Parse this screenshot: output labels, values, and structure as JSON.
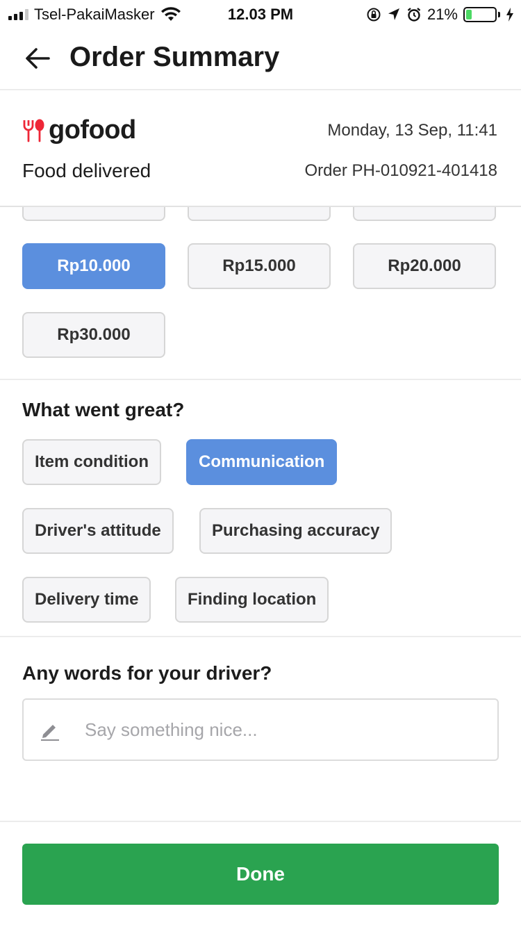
{
  "status_bar": {
    "carrier": "Tsel-PakaiMasker",
    "time": "12.03 PM",
    "battery_percent": "21%",
    "battery_level": 0.21
  },
  "header": {
    "title": "Order Summary"
  },
  "order": {
    "brand": "gofood",
    "brand_color": "#ee2737",
    "date": "Monday, 13 Sep, 11:41",
    "status": "Food delivered",
    "order_id": "Order PH-010921-401418"
  },
  "tip_options": [
    {
      "label": "Rp10.000",
      "selected": true
    },
    {
      "label": "Rp15.000",
      "selected": false
    },
    {
      "label": "Rp20.000",
      "selected": false
    },
    {
      "label": "Rp30.000",
      "selected": false
    }
  ],
  "great": {
    "title": "What went great?",
    "tags": [
      {
        "label": "Item condition",
        "selected": false
      },
      {
        "label": "Communication",
        "selected": true
      },
      {
        "label": "Driver's attitude",
        "selected": false
      },
      {
        "label": "Purchasing accuracy",
        "selected": false
      },
      {
        "label": "Delivery time",
        "selected": false
      },
      {
        "label": "Finding location",
        "selected": false
      }
    ]
  },
  "driver_words": {
    "title": "Any words for your driver?",
    "placeholder": "Say something nice...",
    "value": ""
  },
  "done_label": "Done",
  "colors": {
    "accent": "#5b8fde",
    "primary_button": "#2aa350"
  }
}
